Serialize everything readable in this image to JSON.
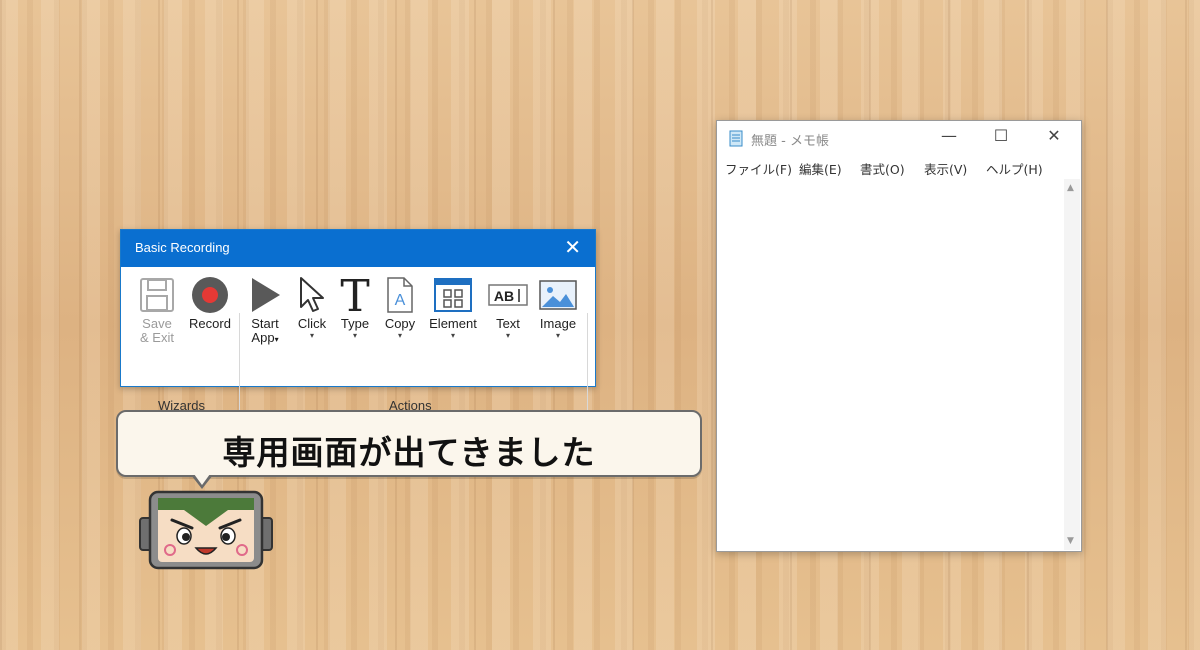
{
  "recording_window": {
    "title": "Basic Recording",
    "close_glyph": "✕",
    "wizards": {
      "group_label": "Wizards",
      "save_exit_label_1": "Save",
      "save_exit_label_2": "& Exit",
      "record_label": "Record"
    },
    "actions": {
      "group_label": "Actions",
      "start_app_label_1": "Start",
      "start_app_label_2": "App",
      "click_label": "Click",
      "type_label": "Type",
      "copy_label": "Copy",
      "element_label": "Element",
      "text_label": "Text",
      "image_label": "Image",
      "caret": "▾"
    },
    "accent_color": "#0a6fd0",
    "record_color": "#e53935"
  },
  "speech_bubble": {
    "text": "専用画面が出てきました"
  },
  "notepad": {
    "title": "無題 - メモ帳",
    "minimize_glyph": "—",
    "maximize_glyph": "☐",
    "close_glyph": "✕",
    "menu": [
      "ファイル(F)",
      "編集(E)",
      "書式(O)",
      "表示(V)",
      "ヘルプ(H)"
    ],
    "content": ""
  }
}
